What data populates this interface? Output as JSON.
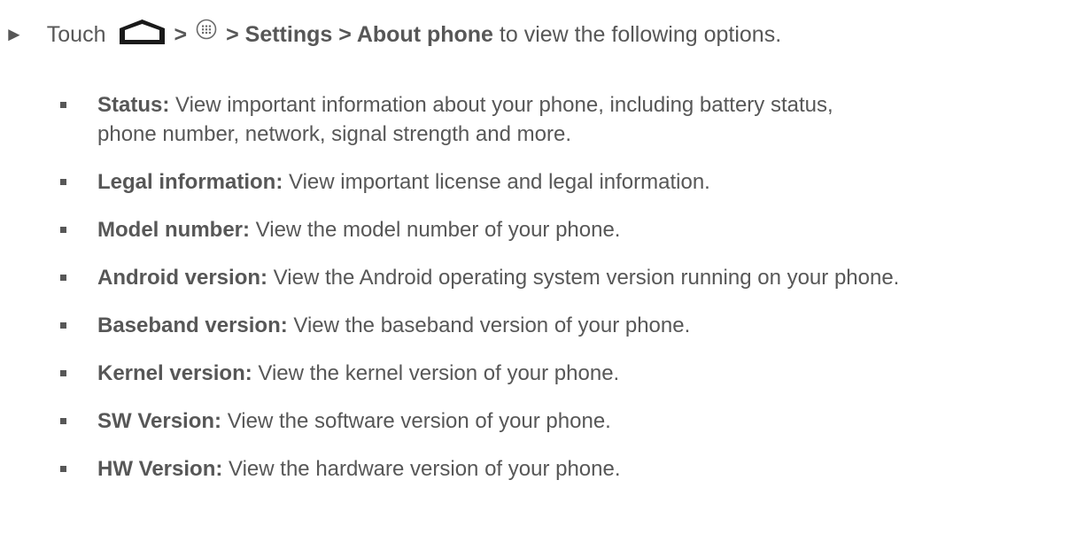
{
  "step": {
    "arrow": "►",
    "touch": "Touch",
    "sep1": ">",
    "path": "> Settings > About phone",
    "suffix": " to view the following options.",
    "icons": [
      "home-icon",
      "apps-icon"
    ]
  },
  "items": [
    {
      "label": "Status:",
      "text": " View important information about your phone, including battery status,",
      "text2": "phone number, network, signal strength and more."
    },
    {
      "label": "Legal information:",
      "text": " View important license and legal information."
    },
    {
      "label": "Model number:",
      "text": " View the model number of your phone."
    },
    {
      "label": "Android version:",
      "text": " View the Android operating system version running on your phone."
    },
    {
      "label": "Baseband version:",
      "text": " View the baseband version of your phone."
    },
    {
      "label": "Kernel version:",
      "text": " View the kernel version of your phone."
    },
    {
      "label": "SW Version:",
      "text": " View the software version of your phone."
    },
    {
      "label": "HW Version:",
      "text": " View the hardware version of your phone."
    }
  ]
}
